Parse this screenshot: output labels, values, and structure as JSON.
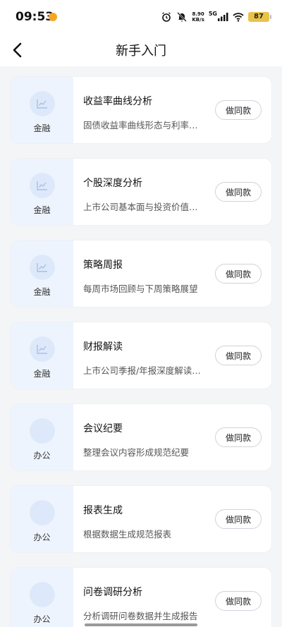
{
  "status_bar": {
    "time": "09:53",
    "net_speed_value": "8.90",
    "net_speed_unit": "KB/s",
    "signal_label": "5G",
    "battery": "87"
  },
  "header": {
    "title": "新手入门"
  },
  "cards": [
    {
      "category": "金融",
      "title": "收益率曲线分析",
      "desc": "固债收益率曲线形态与利率…",
      "button": "做同款",
      "icon": "chart-icon"
    },
    {
      "category": "金融",
      "title": "个股深度分析",
      "desc": "上市公司基本面与投资价值…",
      "button": "做同款",
      "icon": "chart-icon"
    },
    {
      "category": "金融",
      "title": "策略周报",
      "desc": "每周市场回顾与下周策略展望",
      "button": "做同款",
      "icon": "chart-icon"
    },
    {
      "category": "金融",
      "title": "财报解读",
      "desc": "上市公司季报/年报深度解读…",
      "button": "做同款",
      "icon": "chart-icon"
    },
    {
      "category": "办公",
      "title": "会议纪要",
      "desc": "整理会议内容形成规范纪要",
      "button": "做同款",
      "icon": "circle-icon"
    },
    {
      "category": "办公",
      "title": "报表生成",
      "desc": "根据数据生成规范报表",
      "button": "做同款",
      "icon": "circle-icon"
    },
    {
      "category": "办公",
      "title": "问卷调研分析",
      "desc": "分析调研问卷数据并生成报告",
      "button": "做同款",
      "icon": "circle-icon"
    }
  ],
  "colors": {
    "accent_bg": "#eef4fd",
    "icon_bg": "#dde9fb",
    "battery": "#e8c34a"
  }
}
